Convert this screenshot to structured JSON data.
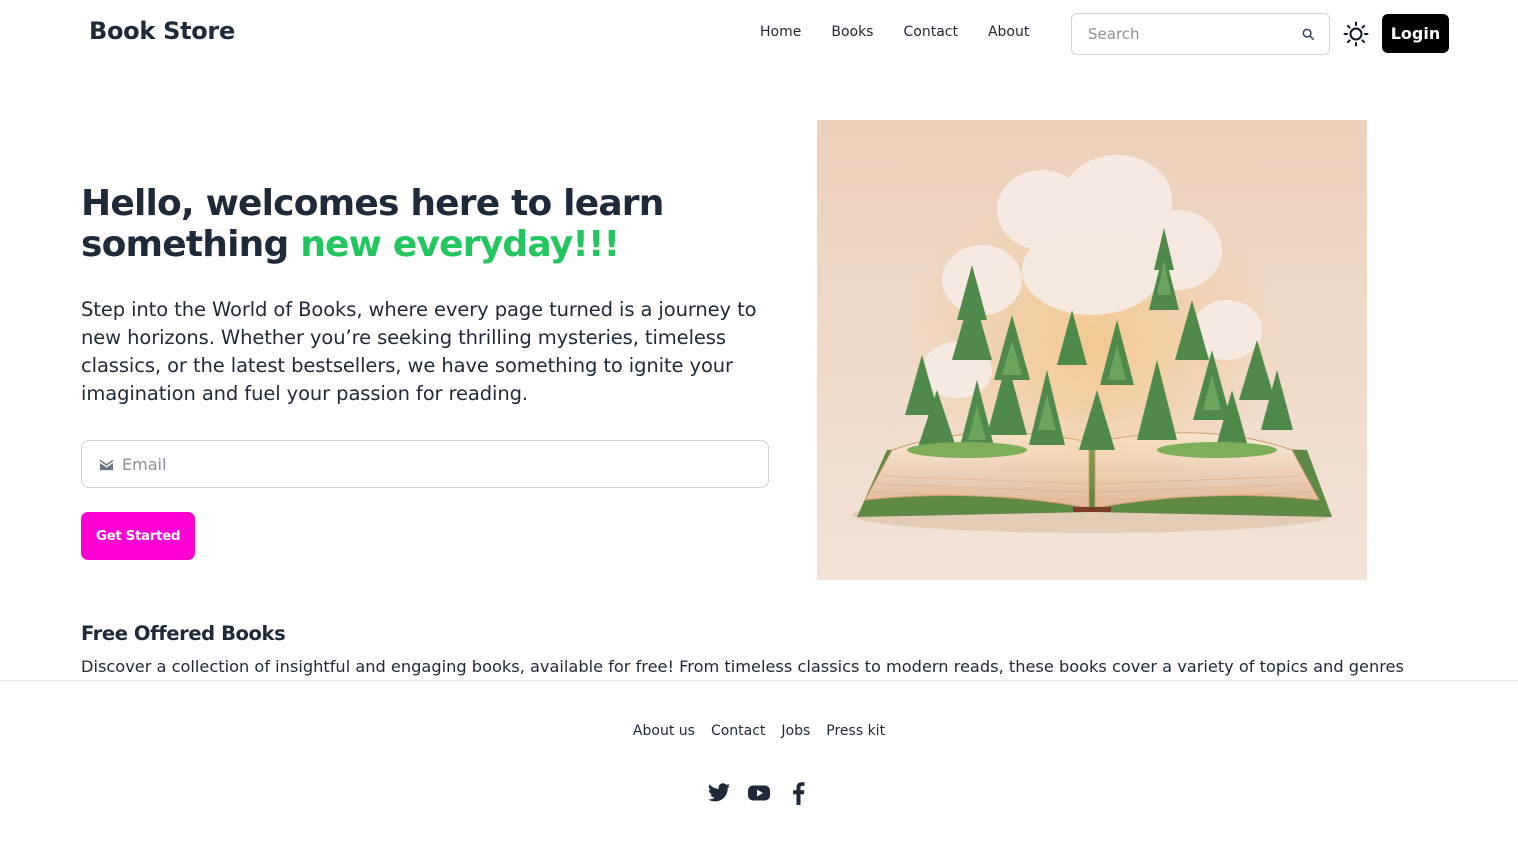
{
  "header": {
    "brand": "Book Store",
    "nav": [
      "Home",
      "Books",
      "Contact",
      "About"
    ],
    "search_placeholder": "Search",
    "login_label": "Login",
    "icons": {
      "search": "search-icon",
      "theme": "sun-icon"
    }
  },
  "hero": {
    "title_part1": "Hello, welcomes here to learn something ",
    "title_highlight": "new everyday!!!",
    "description": "Step into the World of Books, where every page turned is a journey to new horizons. Whether you’re seeking thrilling mysteries, timeless classics, or the latest bestsellers, we have something to ignite your imagination and fuel your passion for reading.",
    "email_placeholder": "Email",
    "cta_label": "Get Started",
    "icons": {
      "email": "mail-icon",
      "image": "open-book-forest-illustration"
    }
  },
  "free_books": {
    "title": "Free Offered Books",
    "description": "Discover a collection of insightful and engaging books, available for free! From timeless classics to modern reads, these books cover a variety of topics and genres"
  },
  "footer": {
    "links": [
      "About us",
      "Contact",
      "Jobs",
      "Press kit"
    ],
    "social_icons": [
      "twitter-icon",
      "youtube-icon",
      "facebook-icon"
    ]
  },
  "colors": {
    "text": "#1f2937",
    "accent_green": "#22c55e",
    "cta_pink": "#ff00d3",
    "login_bg": "#000000",
    "image_bg": "#ecd2bd"
  }
}
